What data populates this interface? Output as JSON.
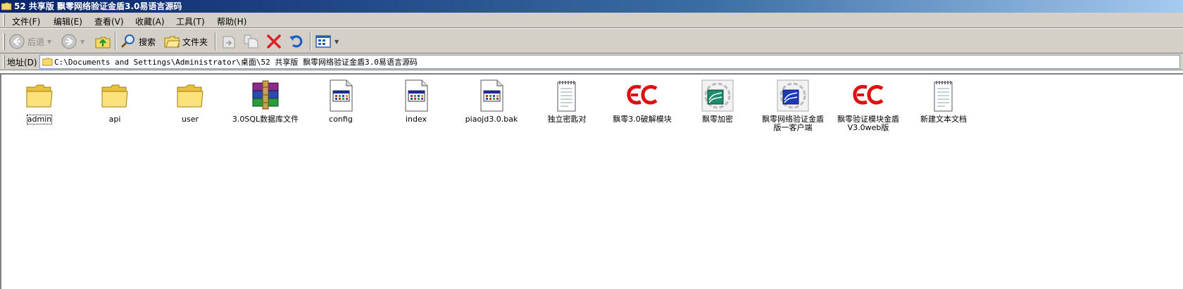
{
  "window": {
    "title": "52 共享版 飘零网络验证金盾3.0易语言源码"
  },
  "menu": {
    "items": [
      "文件(F)",
      "编辑(E)",
      "查看(V)",
      "收藏(A)",
      "工具(T)",
      "帮助(H)"
    ]
  },
  "toolbar": {
    "back_label": "后退",
    "search_label": "搜索",
    "folders_label": "文件夹"
  },
  "address": {
    "label": "地址(D)",
    "path": "C:\\Documents and Settings\\Administrator\\桌面\\52 共享版 飘零网络验证金盾3.0易语言源码"
  },
  "files": [
    {
      "name": "admin",
      "icon": "folder-icon"
    },
    {
      "name": "api",
      "icon": "folder-icon"
    },
    {
      "name": "user",
      "icon": "folder-icon"
    },
    {
      "name": "3.0SQL数据库文件",
      "icon": "winrar-archive-icon"
    },
    {
      "name": "config",
      "icon": "document-icon"
    },
    {
      "name": "index",
      "icon": "document-icon"
    },
    {
      "name": "piaojd3.0.bak",
      "icon": "document-icon"
    },
    {
      "name": "独立密匙对",
      "icon": "notepad-icon"
    },
    {
      "name": "飘零3.0破解模块",
      "icon": "ec-module-icon"
    },
    {
      "name": "飘零加密",
      "icon": "e-source-gray-icon"
    },
    {
      "name": "飘零网络验证金盾版一客户端",
      "icon": "e-source-blue-icon"
    },
    {
      "name": "飘零验证模块金盾V3.0web版",
      "icon": "ec-module-icon"
    },
    {
      "name": "新建文本文档",
      "icon": "notepad-icon"
    }
  ],
  "colors": {
    "titlebar_start": "#0a246a",
    "titlebar_end": "#a6caf0",
    "chrome": "#d4d0c8",
    "ec_red": "#e01010"
  }
}
